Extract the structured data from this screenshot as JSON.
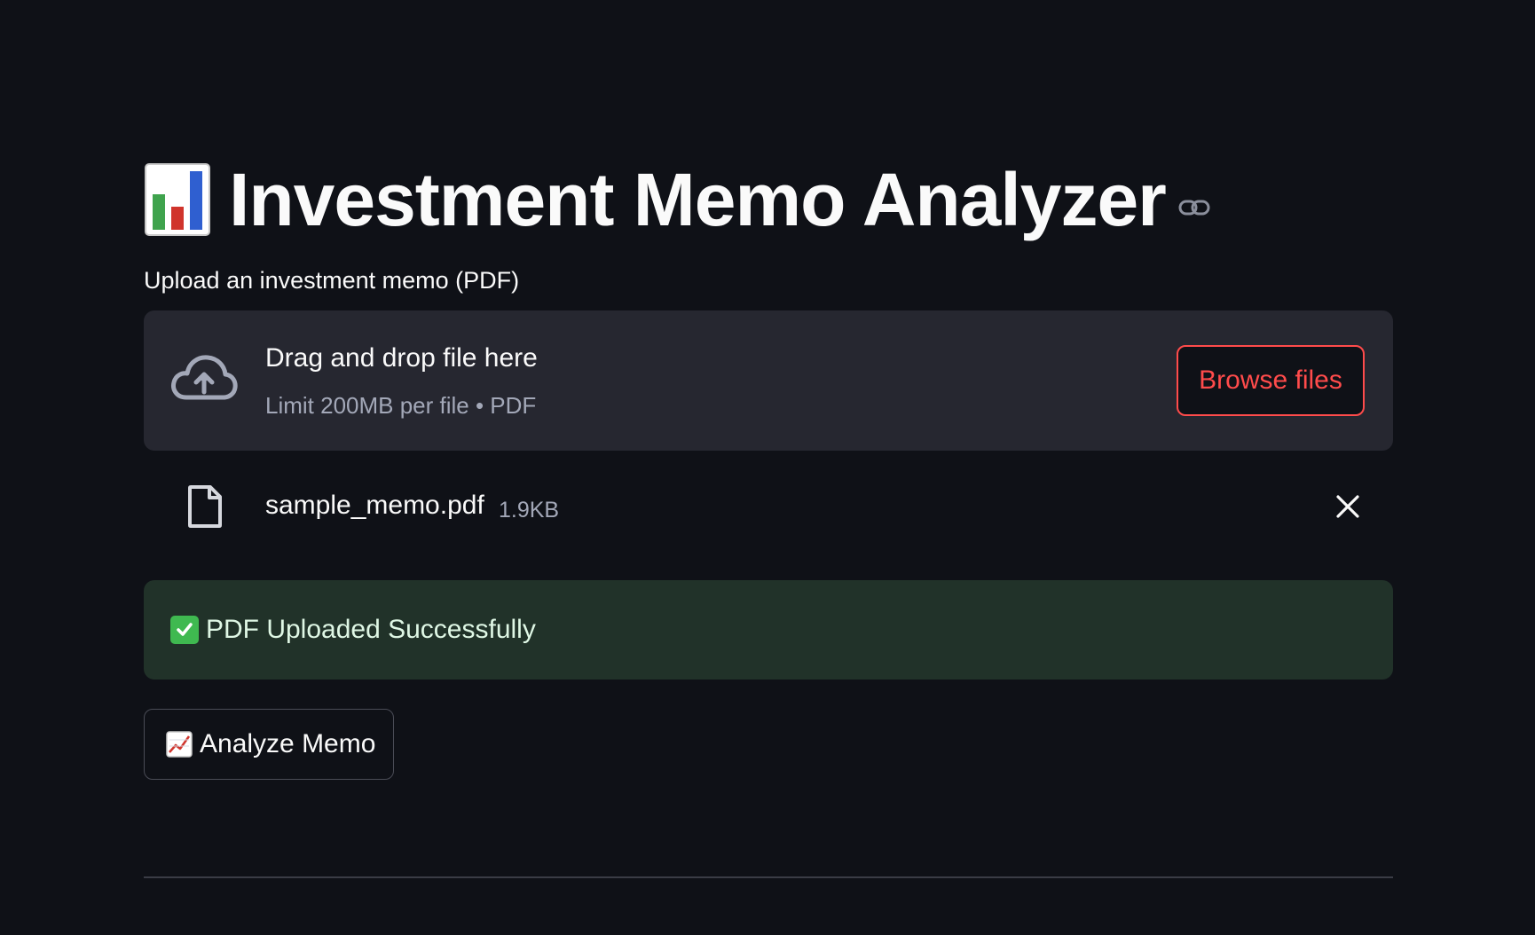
{
  "page": {
    "title": "Investment Memo Analyzer",
    "title_icon": "bar-chart-emoji"
  },
  "uploader": {
    "label": "Upload an investment memo (PDF)",
    "dropzone_text": "Drag and drop file here",
    "dropzone_hint": "Limit 200MB per file • PDF",
    "browse_label": "Browse files",
    "icon": "cloud-upload-icon"
  },
  "uploaded_file": {
    "name": "sample_memo.pdf",
    "size": "1.9KB",
    "icon": "file-icon"
  },
  "status": {
    "message": "PDF Uploaded Successfully",
    "icon": "check-mark-emoji"
  },
  "actions": {
    "analyze_label": "Analyze Memo",
    "analyze_icon": "chart-increasing-emoji"
  },
  "colors": {
    "background": "#0f1117",
    "dropzone": "#262730",
    "accent": "#ff4b4b",
    "success_bg": "#213229"
  }
}
